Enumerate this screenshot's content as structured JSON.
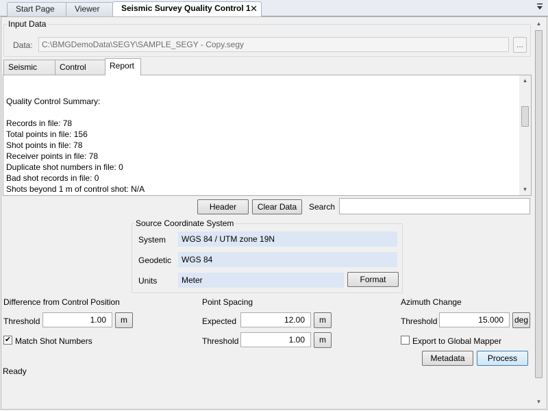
{
  "doc_tabs": [
    {
      "label": "Start Page"
    },
    {
      "label": "Viewer"
    },
    {
      "label": "Seismic Survey Quality Control 1",
      "close": "✕"
    }
  ],
  "input_data": {
    "group_label": "Input Data",
    "data_label": "Data:",
    "data_value": "C:\\BMGDemoData\\SEGY\\SAMPLE_SEGY - Copy.segy",
    "browse_label": "..."
  },
  "inner_tabs": [
    {
      "label": "Seismic File"
    },
    {
      "label": "Control File"
    },
    {
      "label": "Report"
    }
  ],
  "report": {
    "lines": [
      "Quality Control Summary:",
      "",
      "Records in file: 78",
      "Total points in file: 156",
      "Shot points in file: 78",
      "Receiver points in file: 78",
      "Duplicate shot numbers in file: 0",
      "Bad shot records in file: 0",
      "Shots beyond 1 m of control shot: N/A"
    ]
  },
  "toolbar": {
    "header_label": "Header",
    "clear_label": "Clear Data",
    "search_label": "Search",
    "search_value": ""
  },
  "source_cs": {
    "group_label": "Source Coordinate System",
    "system_label": "System",
    "system_value": "WGS 84 / UTM zone 19N",
    "geodetic_label": "Geodetic",
    "geodetic_value": "WGS 84",
    "units_label": "Units",
    "units_value": "Meter",
    "format_label": "Format"
  },
  "control_diff": {
    "title": "Difference from Control Position",
    "threshold_label": "Threshold",
    "threshold_value": "1.00",
    "unit": "m",
    "match_label": "Match Shot Numbers",
    "match_checked": "✔"
  },
  "point_spacing": {
    "title": "Point Spacing",
    "expected_label": "Expected",
    "expected_value": "12.00",
    "expected_unit": "m",
    "threshold_label": "Threshold",
    "threshold_value": "1.00",
    "threshold_unit": "m"
  },
  "azimuth": {
    "title": "Azimuth Change",
    "threshold_label": "Threshold",
    "threshold_value": "15.000",
    "unit": "deg",
    "export_label": "Export to Global Mapper"
  },
  "actions": {
    "metadata_label": "Metadata",
    "process_label": "Process"
  },
  "status": {
    "text": "Ready"
  },
  "colors": {
    "accent": "#3c7fb1",
    "readonly_field": "#dce6f4"
  }
}
